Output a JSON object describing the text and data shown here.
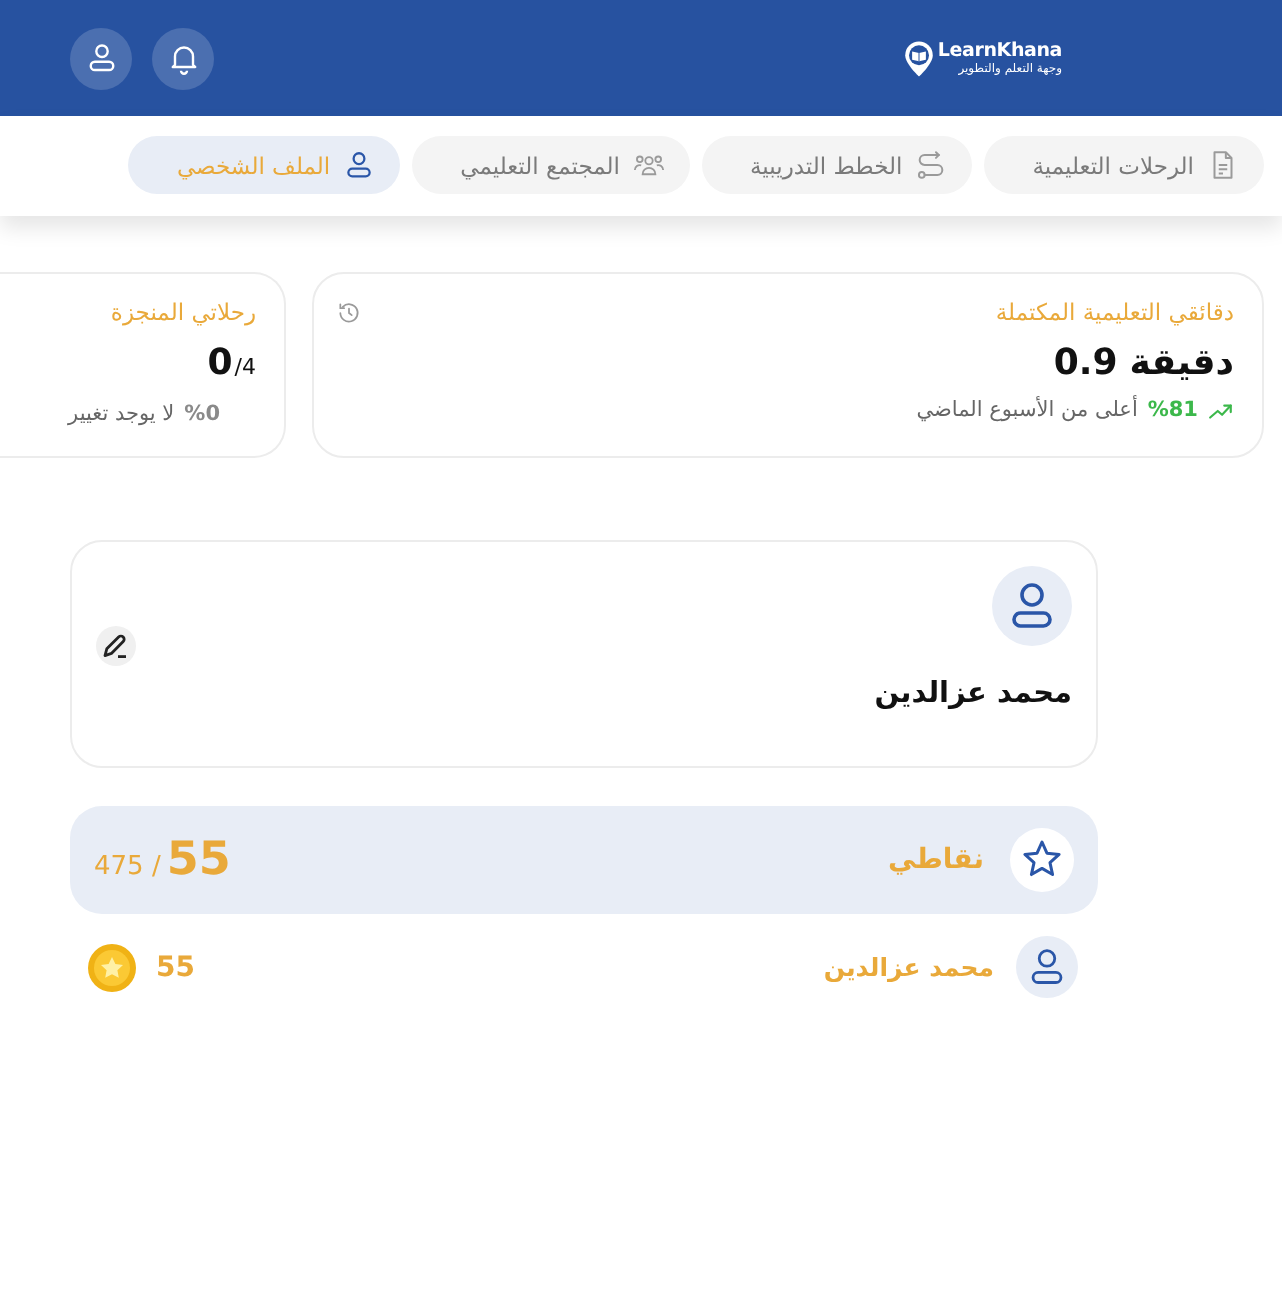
{
  "header": {
    "logo_name": "LearnKhana",
    "logo_tagline": "وجهة التعلم والتطوير"
  },
  "tabs": [
    {
      "label": "الرحلات التعليمية",
      "selected": false
    },
    {
      "label": "الخطط التدريبية",
      "selected": false
    },
    {
      "label": "المجتمع التعليمي",
      "selected": false
    },
    {
      "label": "الملف الشخصي",
      "selected": true
    }
  ],
  "stats": [
    {
      "title": "دقائقي التعليمية المكتملة",
      "value": "0.9",
      "unit": "دقيقة",
      "change": "%81",
      "note": "أعلى من الأسبوع الماضي",
      "rising": true
    },
    {
      "title": "رحلاتي المنجزة",
      "value": "0",
      "total": "/4",
      "change": "%0",
      "note": "لا يوجد تغيير",
      "rising": false
    }
  ],
  "profile": {
    "name": "محمد عزالدين"
  },
  "points": {
    "label": "نقاطي",
    "value": "55",
    "total": "/ 475"
  },
  "leaderboard": [
    {
      "name": "محمد عزالدين",
      "points": "55"
    }
  ]
}
